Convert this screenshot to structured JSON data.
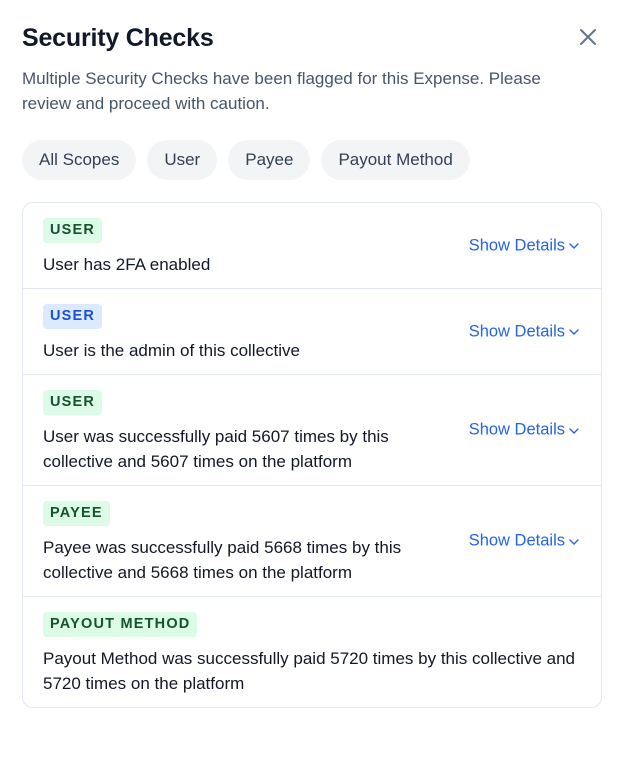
{
  "title": "Security Checks",
  "subtitle": "Multiple Security Checks have been flagged for this Expense. Please review and proceed with caution.",
  "close_icon": "close-icon",
  "filters": [
    {
      "label": "All Scopes"
    },
    {
      "label": "User"
    },
    {
      "label": "Payee"
    },
    {
      "label": "Payout Method"
    }
  ],
  "checks": [
    {
      "scope": "USER",
      "color": "green",
      "message": "User has 2FA enabled",
      "details_label": "Show Details"
    },
    {
      "scope": "USER",
      "color": "blue",
      "message": "User is the admin of this collective",
      "details_label": "Show Details"
    },
    {
      "scope": "USER",
      "color": "green",
      "message": "User was successfully paid 5607 times by this collective and 5607 times on the platform",
      "details_label": "Show Details"
    },
    {
      "scope": "PAYEE",
      "color": "green",
      "message": "Payee was successfully paid 5668 times by this collective and 5668 times on the platform",
      "details_label": "Show Details"
    },
    {
      "scope": "PAYOUT METHOD",
      "color": "green",
      "message": "Payout Method was successfully paid 5720 times by this collective and 5720 times on the platform",
      "details_label": ""
    }
  ],
  "colors": {
    "accent": "#2563eb",
    "badge_green_bg": "#dcfce7",
    "badge_green_text": "#14532d",
    "badge_blue_bg": "#dbeafe",
    "badge_blue_text": "#1d4ed8"
  }
}
